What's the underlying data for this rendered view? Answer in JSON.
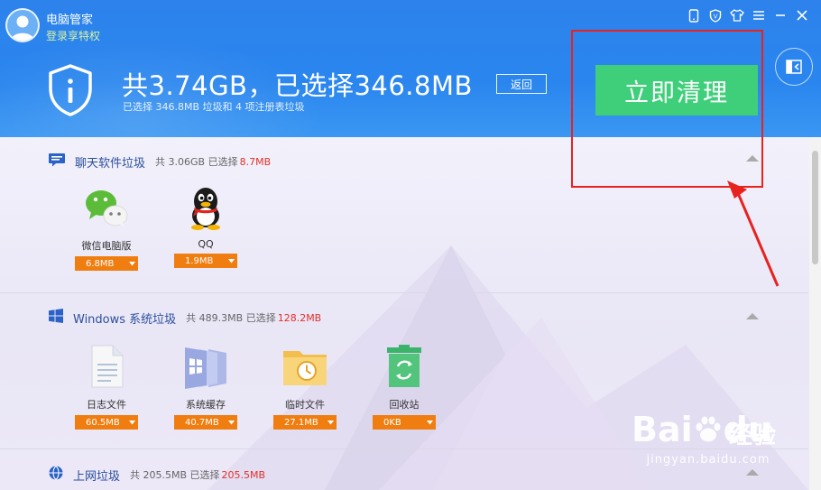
{
  "header": {
    "app_title": "电脑管家",
    "vip_link": "登录享特权",
    "summary": "共3.74GB，已选择346.8MB",
    "summary_sub": "已选择 346.8MB 垃圾和 4 项注册表垃圾",
    "back_label": "返回",
    "clean_label": "立即清理",
    "icons": [
      "phone-icon",
      "shield-badge-icon",
      "shirt-icon",
      "menu-icon",
      "minimize-icon",
      "close-icon"
    ]
  },
  "sections": [
    {
      "title": "聊天软件垃圾",
      "meta": "共 3.06GB 已选择",
      "selected": "8.7MB",
      "items": [
        {
          "name": "微信电脑版",
          "size": "6.8MB",
          "icon": "wechat-icon"
        },
        {
          "name": "QQ",
          "size": "1.9MB",
          "icon": "qq-penguin-icon"
        }
      ]
    },
    {
      "title": "Windows 系统垃圾",
      "meta": "共 489.3MB 已选择",
      "selected": "128.2MB",
      "items": [
        {
          "name": "日志文件",
          "size": "60.5MB",
          "icon": "log-file-icon"
        },
        {
          "name": "系统缓存",
          "size": "40.7MB",
          "icon": "system-cache-icon"
        },
        {
          "name": "临时文件",
          "size": "27.1MB",
          "icon": "temp-folder-icon"
        },
        {
          "name": "回收站",
          "size": "0KB",
          "icon": "recycle-bin-icon"
        }
      ]
    },
    {
      "title": "上网垃圾",
      "meta": "共 205.5MB 已选择",
      "selected": "205.5MB",
      "items": []
    }
  ],
  "watermark": {
    "brand": "Bai",
    "brand2": "du",
    "jingyan": "经验",
    "url": "jingyan.baidu.com"
  },
  "colors": {
    "header_blue": "#2d82ec",
    "clean_green": "#3fcf7a",
    "size_orange": "#f07d10",
    "selected_red": "#e2322a",
    "annotation_red": "#e8221f"
  }
}
